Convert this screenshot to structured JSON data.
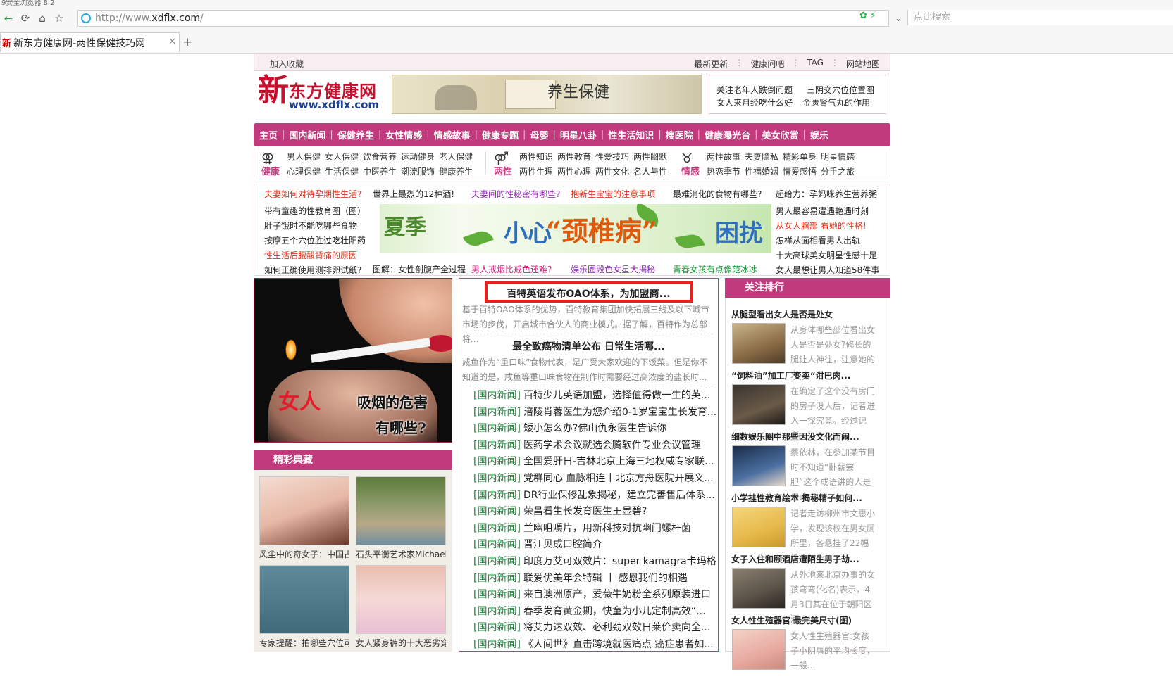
{
  "browser": {
    "window_title": "9安全浏览器 8.2",
    "url_prefix": "http://www.",
    "url_domain": "xdflx.com",
    "url_suffix": "/",
    "search_placeholder": "点此搜索",
    "tab_favicon": "新",
    "tab_title": "新东方健康网-两性保健技巧网",
    "new_tab": "+"
  },
  "topbar": {
    "favorite": "加入收藏",
    "links": [
      "最新更新",
      "健康问吧",
      "TAG",
      "网站地图"
    ]
  },
  "header": {
    "logo_char": "新",
    "logo_name": "东方健康网",
    "logo_url": "www.xdflx.com",
    "banner_text": "养生保健",
    "links": [
      "关注老年人跌倒问题",
      "三阴交穴位位置图",
      "女人来月经吃什么好",
      "金匮肾气丸的作用"
    ]
  },
  "mainnav": [
    "主页",
    "国内新闻",
    "保健养生",
    "女性情感",
    "情感故事",
    "健康专题",
    "母婴",
    "明星八卦",
    "性生活知识",
    "搜医院",
    "健康曝光台",
    "美女欣赏",
    "娱乐"
  ],
  "subnav": [
    {
      "icon": "⚢",
      "label": "健康",
      "links": [
        "男人保健",
        "女人保健",
        "饮食营养",
        "运动健身",
        "老人保健",
        "心理保健",
        "生活保健",
        "中医养生",
        "潮流服饰",
        "健康养生"
      ]
    },
    {
      "icon": "⚤",
      "label": "两性",
      "links": [
        "两性知识",
        "两性教育",
        "性爱技巧",
        "两性幽默",
        "两性生理",
        "两性心理",
        "两性文化",
        "名人与性"
      ]
    },
    {
      "icon": "♉",
      "label": "情感",
      "links": [
        "两性故事",
        "夫妻隐私",
        "精彩单身",
        "明星情感",
        "热恋季节",
        "性福婚姻",
        "情爱感悟",
        "分手之旅"
      ]
    }
  ],
  "hot": {
    "row1": [
      "夫妻如何对待孕期性生活?",
      "世界上最烈的12种酒!",
      "夫妻间的性秘密有哪些?",
      "抱新生宝宝的注意事项",
      "最难消化的食物有哪些?",
      "超给力：孕妈咪养生营养粥"
    ],
    "left": [
      "带有童趣的性教育图（图）",
      "肚子饿时不能吃哪些食物",
      "按摩五个穴位胜过吃壮阳药",
      "性生活后腰酸背痛的原因",
      "如何正确使用测排卵试纸?"
    ],
    "right": [
      "男人最容易遭遇艳遇时刻",
      "从女人胸部 看她的性格!",
      "怎样从面相看男人出轨",
      "十大高球美女明星性感十足",
      "女人最想让男人知道58件事"
    ],
    "bottom": [
      "图解：女性剖腹产全过程",
      "男人戒烟比戒色还难?",
      "娱乐圈毁色女星大揭秘",
      "青春女孩有点像范冰冰"
    ],
    "banner": {
      "t1": "夏季",
      "t2": "小心",
      "t3": "“颈椎病”",
      "t4": "困扰"
    }
  },
  "smoke": {
    "c1": "女人",
    "c2": "吸烟的危害",
    "c3": "有哪些?"
  },
  "jingcai": {
    "title": "精彩典藏",
    "items": [
      "风尘中的奇女子：中国古",
      "石头平衡艺术家Michael",
      "专家提醒：拍哪些穴位可",
      "女人紧身裤的十大恶劣穿"
    ]
  },
  "middle": {
    "headline1": "百特英语发布OAO体系，为加盟商...",
    "summary1": "基于百特OAO体系的优势，百特教育集团加快拓展三线及以下城市市场的步伐，开启城市合伙人的商业模式。据了解，百特作为总部将...",
    "headline2": "最全致癌物清单公布 日常生活哪...",
    "summary2": "咸鱼作为“重口味”食物代表，是广受大家欢迎的下饭菜。但是你不知道的是，咸鱼等重口味食物在制作时需要经过高浓度的盐长时...",
    "category": "[国内新闻]",
    "news": [
      "百特少儿英语加盟，选择值得做一生的英...",
      "涪陵肖蓉医生为您介绍0-1岁宝宝生长发育...",
      "矮小怎么办?佛山仇永医生告诉你",
      "医药学术会议就选会腾软件专业会议管理",
      "全国爱肝日-吉林北京上海三地权威专家联...",
      "党群同心 血脉相连丨北京方舟医院开展义...",
      "DR行业保修乱象揭秘，建立完善售后体系...",
      "荣昌看生长发育医生王显碧?",
      "兰幽咀嚼片，用新科技对抗幽门螺杆菌",
      "晋江贝成口腔简介",
      "印度万艾可双效片：super kamagra卡玛格...",
      "联爱优美年会特辑 丨 感恩我们的相遇",
      "来自澳洲原产，爱薇牛奶粉全系列原装进口",
      "春季发育黄金期，快童为小儿定制高效“...",
      "将艾力达双效、必利劲双效日莱价卖向全...",
      "《人间世》直击跨境就医痛点 癌症患者如..."
    ]
  },
  "right": {
    "title": "关注排行",
    "items": [
      {
        "title": "从腿型看出女人是否是处女",
        "text": "从身体哪些部位看出女人是否是处女?修长的腿让人神往，注意她的大..."
      },
      {
        "title": "“饲料油”加工厂变卖“泔巴肉...",
        "text": "在确定了这个没有房门的房子没人后，记者进入一探究竟。经过记者..."
      },
      {
        "title": "细数娱乐圈中那些因没文化而闹...",
        "text": "蔡依林，在参加某节目时不知道“卧薪尝胆”这个成语讲的人是勾践..."
      },
      {
        "title": "小学挂性教育绘本 揭秘精子如何...",
        "text": "记者走访柳州市文惠小学，发现该校在男女厕所里，各悬挂了22幅绘..."
      },
      {
        "title": "女子入住和颐酒店遭陌生男子劫...",
        "text": "从外地来北京办事的女孩弯弯(化名)表示，4月3日其在位于朝阳区酒..."
      },
      {
        "title": "女人性生殖器官 最完美尺寸(图)",
        "text": "女人性生殖器官:女孩子小阴唇的平均长度，一般..."
      }
    ]
  }
}
